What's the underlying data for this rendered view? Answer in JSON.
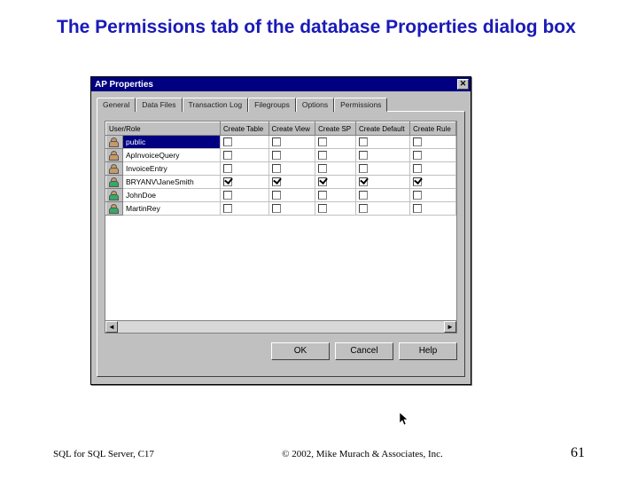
{
  "slide": {
    "title": "The Permissions tab of the database Properties dialog box"
  },
  "dialog": {
    "title": "AP Properties",
    "close_glyph": "✕",
    "tabs": [
      "General",
      "Data Files",
      "Transaction Log",
      "Filegroups",
      "Options",
      "Permissions"
    ],
    "active_tab": 5,
    "columns": [
      "User/Role",
      "Create Table",
      "Create View",
      "Create SP",
      "Create Default",
      "Create Rule"
    ],
    "rows": [
      {
        "icon": "role",
        "name": "public",
        "checks": [
          false,
          false,
          false,
          false,
          false
        ],
        "selected": true
      },
      {
        "icon": "role",
        "name": "ApInvoiceQuery",
        "checks": [
          false,
          false,
          false,
          false,
          false
        ]
      },
      {
        "icon": "role",
        "name": "InvoiceEntry",
        "checks": [
          false,
          false,
          false,
          false,
          false
        ]
      },
      {
        "icon": "user",
        "name": "BRYANV\\JaneSmith",
        "checks": [
          true,
          true,
          true,
          true,
          true
        ]
      },
      {
        "icon": "user",
        "name": "JohnDoe",
        "checks": [
          false,
          false,
          false,
          false,
          false
        ]
      },
      {
        "icon": "user",
        "name": "MartinRey",
        "checks": [
          false,
          false,
          false,
          false,
          false
        ]
      }
    ],
    "buttons": {
      "ok": "OK",
      "cancel": "Cancel",
      "help": "Help"
    },
    "scroll": {
      "left": "◄",
      "right": "►"
    }
  },
  "footer": {
    "left": "SQL for SQL Server, C17",
    "center": "© 2002, Mike Murach & Associates, Inc.",
    "page": "61"
  }
}
